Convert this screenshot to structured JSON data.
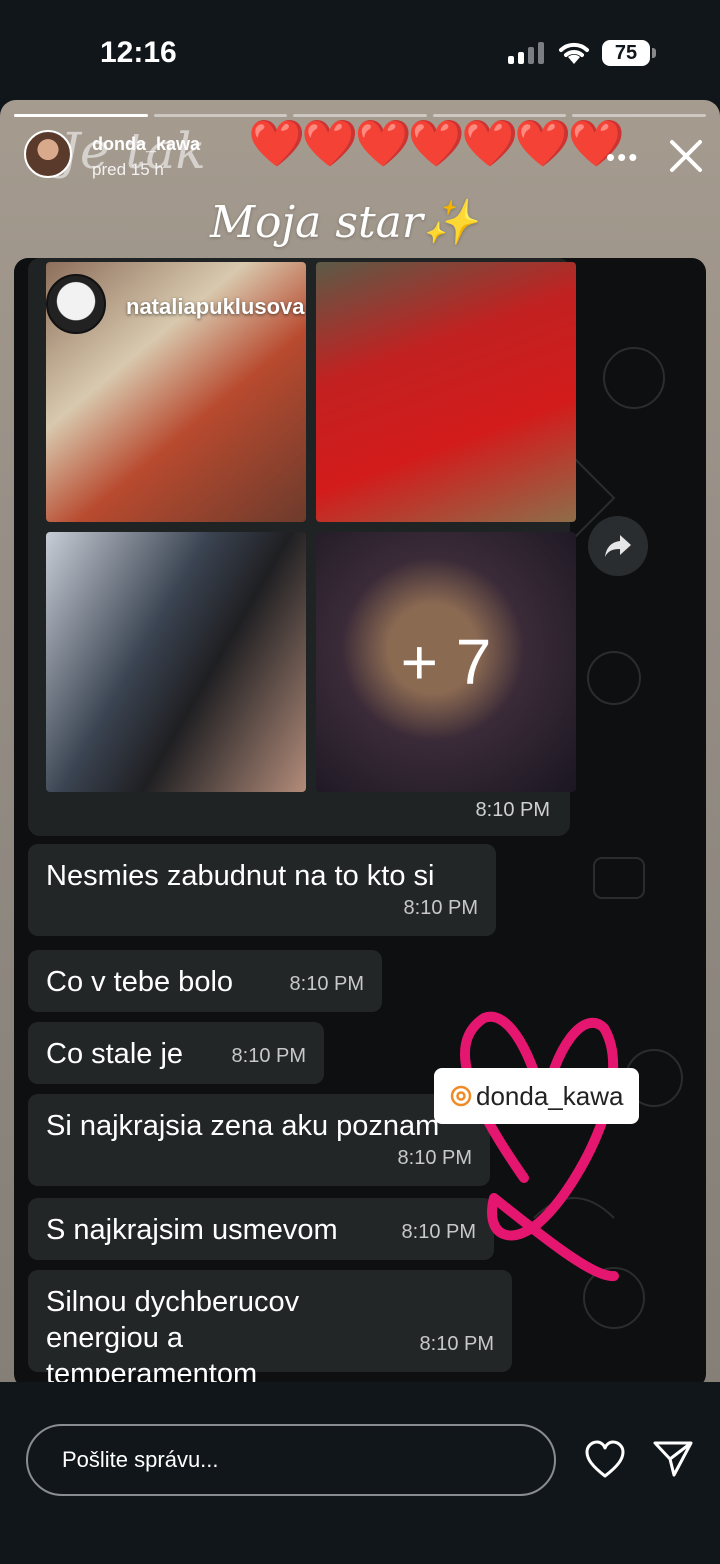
{
  "status_bar": {
    "time": "12:16",
    "battery": "75"
  },
  "story": {
    "username": "donda_kawa",
    "posted": "pred 15 h",
    "ghost_text": "Je tak",
    "hearts": "❤️❤️❤️❤️❤️❤️❤️",
    "caption": "Moja star✨",
    "more_icon": "more-dots-icon",
    "close_icon": "close-icon",
    "progress_segments": 5,
    "progress_done": 1
  },
  "chat": {
    "media": {
      "sender": "nataliapuklusova",
      "more_count": "+ 7",
      "time": "8:10 PM"
    },
    "messages": [
      {
        "text": "Nesmies zabudnut na to kto si",
        "time": "8:10 PM"
      },
      {
        "text": "Co v tebe bolo",
        "time": "8:10 PM"
      },
      {
        "text": "Co stale je",
        "time": "8:10 PM"
      },
      {
        "text": "Si najkrajsia zena aku poznam",
        "time": "8:10 PM"
      },
      {
        "text": "S najkrajsim usmevom",
        "time": "8:10 PM"
      },
      {
        "text": "Silnou dychberucov energiou a temperamentom",
        "time": "8:10 PM"
      }
    ],
    "mention": "donda_kawa"
  },
  "reply": {
    "placeholder": "Pošlite správu..."
  },
  "colors": {
    "background": "#11161b",
    "bubble": "#232627",
    "heart_red": "#e01818",
    "scribble_pink": "#e5166f"
  }
}
